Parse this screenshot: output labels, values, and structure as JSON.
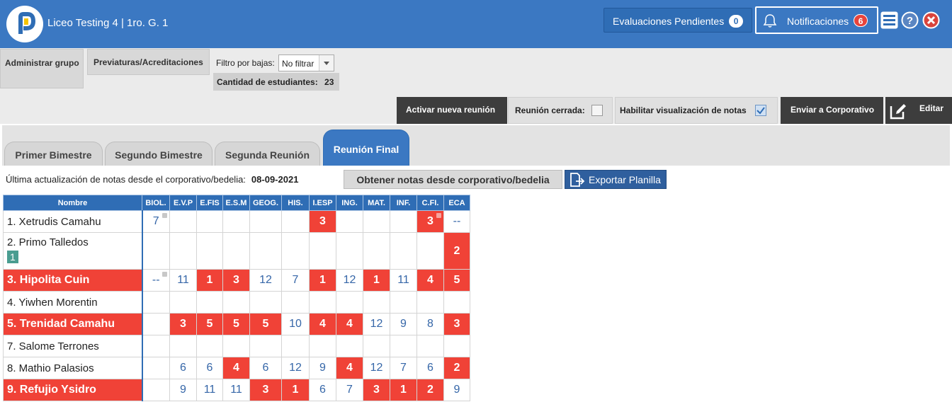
{
  "header": {
    "school": "Liceo Testing 4 | 1ro. G. 1",
    "pending_label": "Evaluaciones Pendientes",
    "pending_count": "0",
    "notif_label": "Notificaciones",
    "notif_count": "6"
  },
  "toolbar": {
    "admin_group": "Administrar grupo",
    "previaturas": "Previaturas/Acreditaciones",
    "filter_label": "Filtro por bajas:",
    "filter_value": "No filtrar",
    "count_label": "Cantidad de estudiantes:",
    "count_value": "23",
    "activate_meeting": "Activar nueva reunión",
    "meeting_closed": "Reunión cerrada:",
    "enable_grades": "Habilitar visualización de notas",
    "send_corporate": "Enviar a Corporativo",
    "edit": "Editar"
  },
  "tabs": [
    "Primer Bimestre",
    "Segundo Bimestre",
    "Segunda Reunión",
    "Reunión Final"
  ],
  "update": {
    "label": "Última actualización de notas desde el corporativo/bedelia:",
    "date": "08-09-2021",
    "fetch_button": "Obtener notas desde corporativo/bedelia",
    "export_button": "Exportar Planilla"
  },
  "table": {
    "name_header": "Nombre",
    "subjects": [
      "BIOL.",
      "E.V.P",
      "E.FIS",
      "E.S.M",
      "GEOG.",
      "HIS.",
      "I.ESP",
      "ING.",
      "MAT.",
      "INF.",
      "C.FI.",
      "ECA"
    ],
    "rows": [
      {
        "name": "1. Xetrudis Camahu",
        "grades": [
          "7",
          "",
          "",
          "",
          "",
          "",
          "3",
          "",
          "",
          "",
          "3",
          "--"
        ]
      },
      {
        "name": "2. Primo Talledos",
        "badge": "1",
        "grades": [
          "",
          "",
          "",
          "",
          "",
          "",
          "",
          "",
          "",
          "",
          "",
          "2"
        ]
      },
      {
        "name": "3. Hipolita Cuin",
        "grades": [
          "--",
          "11",
          "1",
          "3",
          "12",
          "7",
          "1",
          "12",
          "1",
          "11",
          "4",
          "5"
        ]
      },
      {
        "name": "4. Yiwhen Morentin",
        "grades": [
          "",
          "",
          "",
          "",
          "",
          "",
          "",
          "",
          "",
          "",
          "",
          ""
        ]
      },
      {
        "name": "5. Trenidad Camahu",
        "grades": [
          "",
          "3",
          "5",
          "5",
          "5",
          "10",
          "4",
          "4",
          "12",
          "9",
          "8",
          "3"
        ]
      },
      {
        "name": "7. Salome Terrones",
        "grades": [
          "",
          "",
          "",
          "",
          "",
          "",
          "",
          "",
          "",
          "",
          "",
          ""
        ]
      },
      {
        "name": "8. Mathio Palasios",
        "grades": [
          "",
          "6",
          "6",
          "4",
          "6",
          "12",
          "9",
          "4",
          "12",
          "7",
          "6",
          "2"
        ]
      },
      {
        "name": "9. Refujio Ysidro",
        "grades": [
          "",
          "9",
          "11",
          "11",
          "3",
          "1",
          "6",
          "7",
          "3",
          "1",
          "2",
          "9"
        ]
      }
    ]
  },
  "colors": {
    "primary": "#3b78c2",
    "fail": "#f04237",
    "dark": "#3d3d3d"
  }
}
